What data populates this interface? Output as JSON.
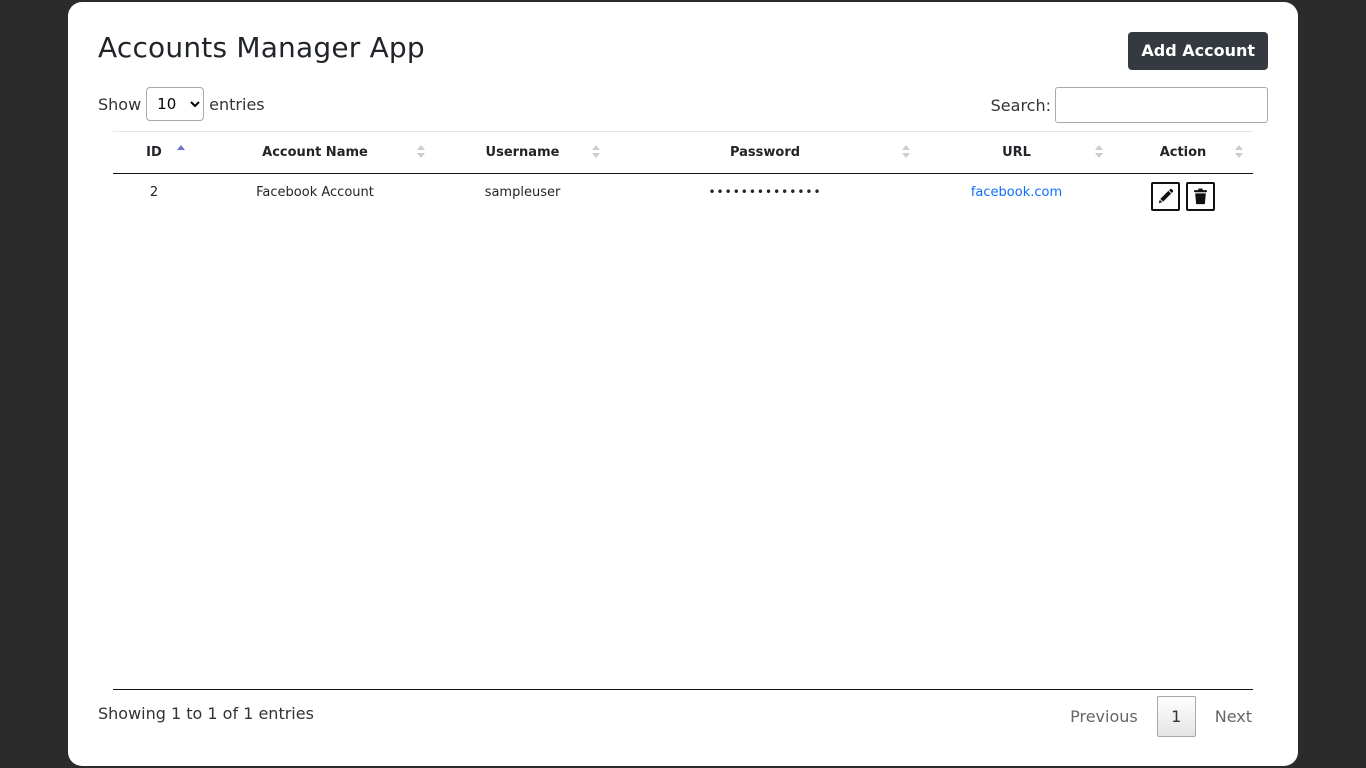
{
  "app": {
    "title": "Accounts Manager App",
    "add_button": "Add Account"
  },
  "controls": {
    "show_label": "Show",
    "entries_value": "10",
    "entries_label": "entries",
    "search_label": "Search:",
    "search_value": ""
  },
  "table": {
    "columns": [
      "ID",
      "Account Name",
      "Username",
      "Password",
      "URL",
      "Action"
    ],
    "sorted_column": "ID",
    "sort_direction": "ascending",
    "rows": [
      {
        "id": "2",
        "account_name": "Facebook Account",
        "username": "sampleuser",
        "password": "••••••••••••••",
        "url": "facebook.com"
      }
    ]
  },
  "footer": {
    "info": "Showing 1 to 1 of 1 entries",
    "previous": "Previous",
    "current_page": "1",
    "next": "Next"
  },
  "colors": {
    "page_background": "#2b2b2b",
    "button_dark": "#343a40",
    "link": "#0d6efd",
    "sort_active": "#6f73c9"
  },
  "icons": {
    "edit": "pencil-icon",
    "delete": "trash-icon"
  }
}
